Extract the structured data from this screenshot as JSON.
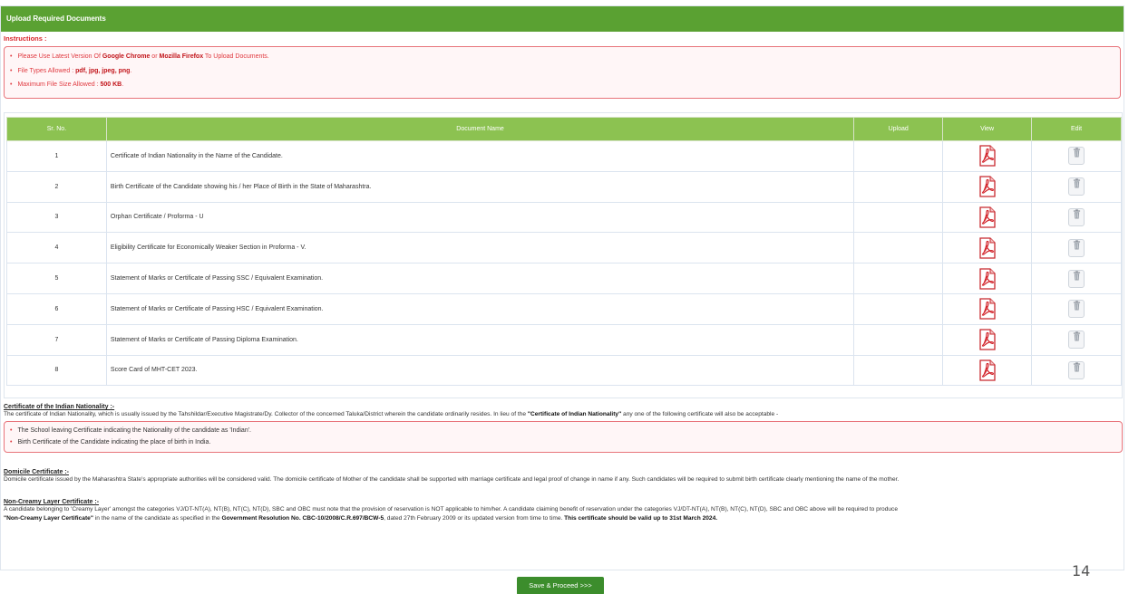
{
  "header": {
    "title": "Upload Required Documents"
  },
  "instructions": {
    "title": "Instructions :",
    "items": [
      {
        "pre": "Please Use Latest Version Of ",
        "b1": "Google Chrome",
        "mid": " or ",
        "b2": "Mozilla Firefox",
        "post": " To Upload Documents."
      },
      {
        "pre": "File Types Allowed : ",
        "b1": "pdf, jpg, jpeg, png",
        "post": "."
      },
      {
        "pre": "Maximum File Size Allowed : ",
        "b1": "500 KB",
        "post": "."
      }
    ]
  },
  "table": {
    "headers": {
      "sr": "Sr. No.",
      "name": "Document Name",
      "upload": "Upload",
      "view": "View",
      "edit": "Edit"
    },
    "rows": [
      {
        "sr": "1",
        "name": "Certificate of Indian Nationality in the Name of the Candidate."
      },
      {
        "sr": "2",
        "name": "Birth Certificate of the Candidate showing his / her Place of Birth in the State of Maharashtra."
      },
      {
        "sr": "3",
        "name": "Orphan Certificate / Proforma - U"
      },
      {
        "sr": "4",
        "name": "Eligibility Certificate for Economically Weaker Section in Proforma - V."
      },
      {
        "sr": "5",
        "name": "Statement of Marks or Certificate of Passing SSC / Equivalent Examination."
      },
      {
        "sr": "6",
        "name": "Statement of Marks or Certificate of Passing HSC / Equivalent Examination."
      },
      {
        "sr": "7",
        "name": "Statement of Marks or Certificate of Passing Diploma Examination."
      },
      {
        "sr": "8",
        "name": "Score Card of MHT-CET 2023."
      }
    ]
  },
  "nationality": {
    "heading": "Certificate of the Indian Nationality :-",
    "text_pre": "The certificate of Indian Nationality, which is usually issued by the Tahshildar/Executive Magistrate/Dy. Collector of the concerned Taluka/District wherein the candidate ordinarily resides. In lieu of the ",
    "text_bold": "\"Certificate of Indian Nationality\"",
    "text_post": " any one of the following certificate will also be acceptable -",
    "items": [
      "The School leaving Certificate indicating the Nationality of the candidate as 'Indian'.",
      "Birth Certificate of the Candidate indicating the place of birth in India."
    ]
  },
  "domicile": {
    "heading": "Domicile Certificate :-",
    "text": "Domicile certificate issued by the Maharashtra State's appropriate authorities will be considered valid. The domicile certificate of Mother of the candidate shall be supported with marriage certificate and legal proof of change in name if any. Such candidates will be required to submit birth certificate clearly mentioning the name of the mother."
  },
  "noncreamy": {
    "heading": "Non-Creamy Layer Certificate :-",
    "text1": "A candidate belonging to 'Creamy Layer' amongst the categories VJ/DT-NT(A), NT(B), NT(C), NT(D), SBC and OBC must note that the provision of reservation is NOT applicable to him/her. A candidate claiming benefit of reservation under the categories VJ/DT-NT(A), NT(B), NT(C), NT(D), SBC and OBC above will be required to produce",
    "b1": "\"Non-Creamy Layer Certificate\"",
    "t2": " in the name of the candidate as specified in the ",
    "b2": "Government Resolution No. CBC-10/2008/C.R.697/BCW-5",
    "t3": ", dated 27th February 2009 or its updated version from time to time. ",
    "b3": "This certificate should be valid up to 31st March 2024."
  },
  "actions": {
    "save_label": "Save & Proceed >>>"
  },
  "page_number": "14",
  "colors": {
    "header": "#5aa132",
    "table_header": "#8cc251",
    "instruction_red": "#e03a40",
    "button": "#3c8d2c"
  }
}
